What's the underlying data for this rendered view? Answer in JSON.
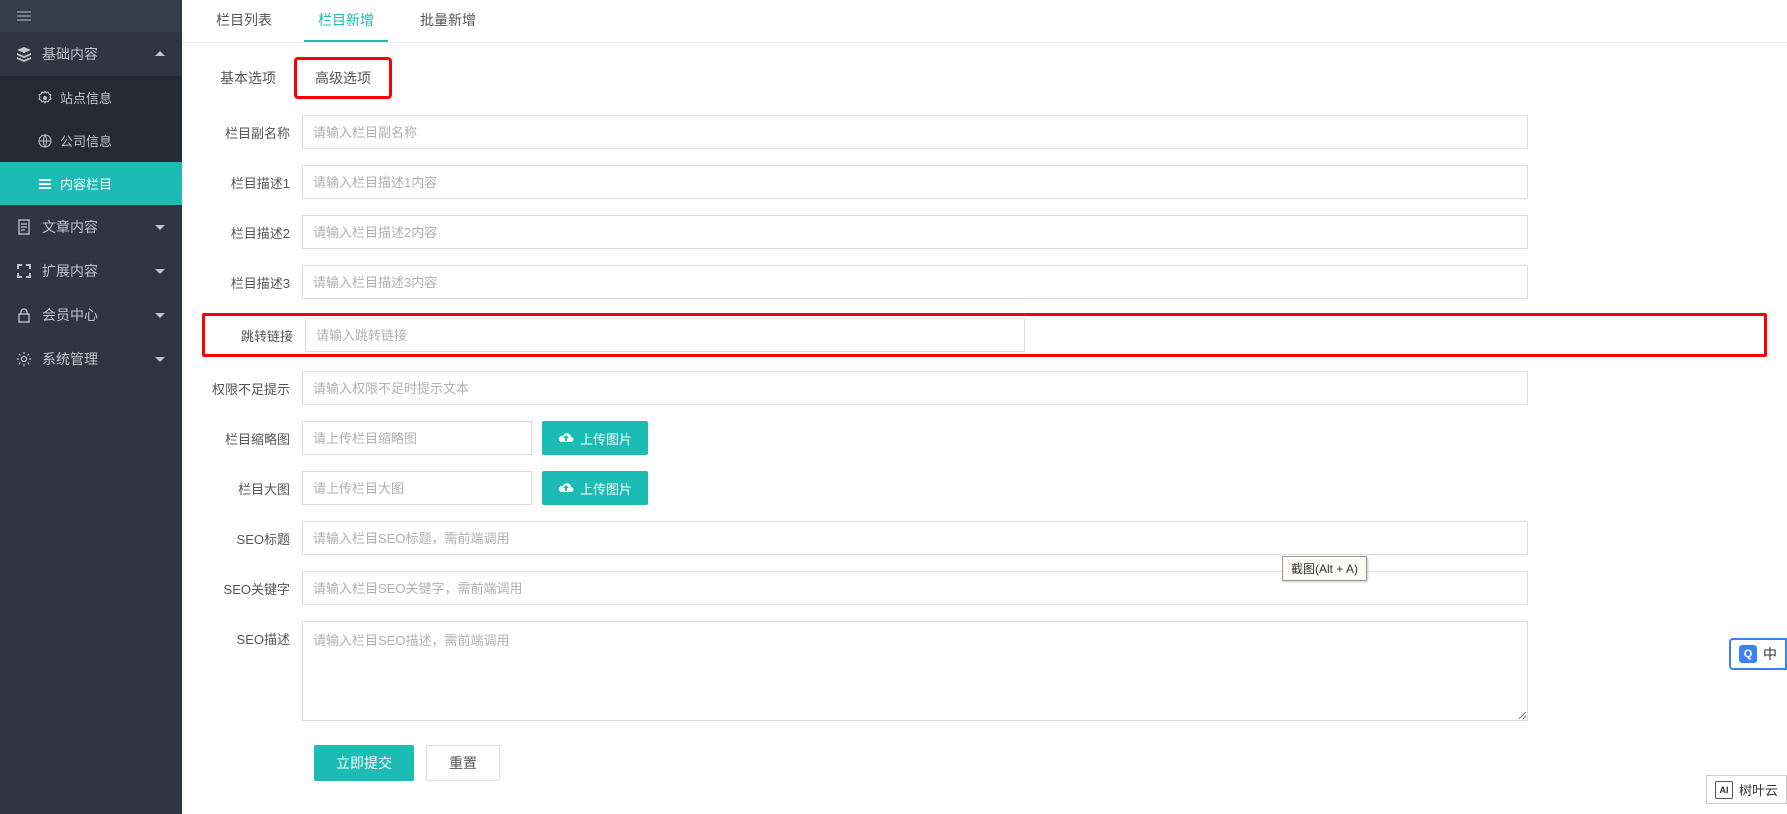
{
  "sidebar": {
    "top": "",
    "items": [
      {
        "label": "基础内容",
        "expanded": true,
        "children": [
          {
            "label": "站点信息"
          },
          {
            "label": "公司信息"
          },
          {
            "label": "内容栏目",
            "active": true
          }
        ]
      },
      {
        "label": "文章内容"
      },
      {
        "label": "扩展内容"
      },
      {
        "label": "会员中心"
      },
      {
        "label": "系统管理"
      }
    ]
  },
  "tabs_top": [
    {
      "label": "栏目列表"
    },
    {
      "label": "栏目新增",
      "active": true
    },
    {
      "label": "批量新增"
    }
  ],
  "tabs_sub": [
    {
      "label": "基本选项"
    },
    {
      "label": "高级选项",
      "highlighted": true
    }
  ],
  "form": {
    "subtitle": {
      "label": "栏目副名称",
      "placeholder": "请输入栏目副名称"
    },
    "desc1": {
      "label": "栏目描述1",
      "placeholder": "请输入栏目描述1内容"
    },
    "desc2": {
      "label": "栏目描述2",
      "placeholder": "请输入栏目描述2内容"
    },
    "desc3": {
      "label": "栏目描述3",
      "placeholder": "请输入栏目描述3内容"
    },
    "jump": {
      "label": "跳转链接",
      "placeholder": "请输入跳转链接"
    },
    "noauth": {
      "label": "权限不足提示",
      "placeholder": "请输入权限不足时提示文本"
    },
    "thumb": {
      "label": "栏目缩略图",
      "placeholder": "请上传栏目缩略图",
      "btn": "上传图片"
    },
    "bigimg": {
      "label": "栏目大图",
      "placeholder": "请上传栏目大图",
      "btn": "上传图片"
    },
    "seo_title": {
      "label": "SEO标题",
      "placeholder": "请输入栏目SEO标题，需前端调用"
    },
    "seo_keyword": {
      "label": "SEO关键字",
      "placeholder": "请输入栏目SEO关键字，需前端调用"
    },
    "seo_desc": {
      "label": "SEO描述",
      "placeholder": "请输入栏目SEO描述，需前端调用"
    }
  },
  "actions": {
    "submit": "立即提交",
    "reset": "重置"
  },
  "tooltip": "截图(Alt + A)",
  "ime": "中",
  "brand": "树叶云"
}
